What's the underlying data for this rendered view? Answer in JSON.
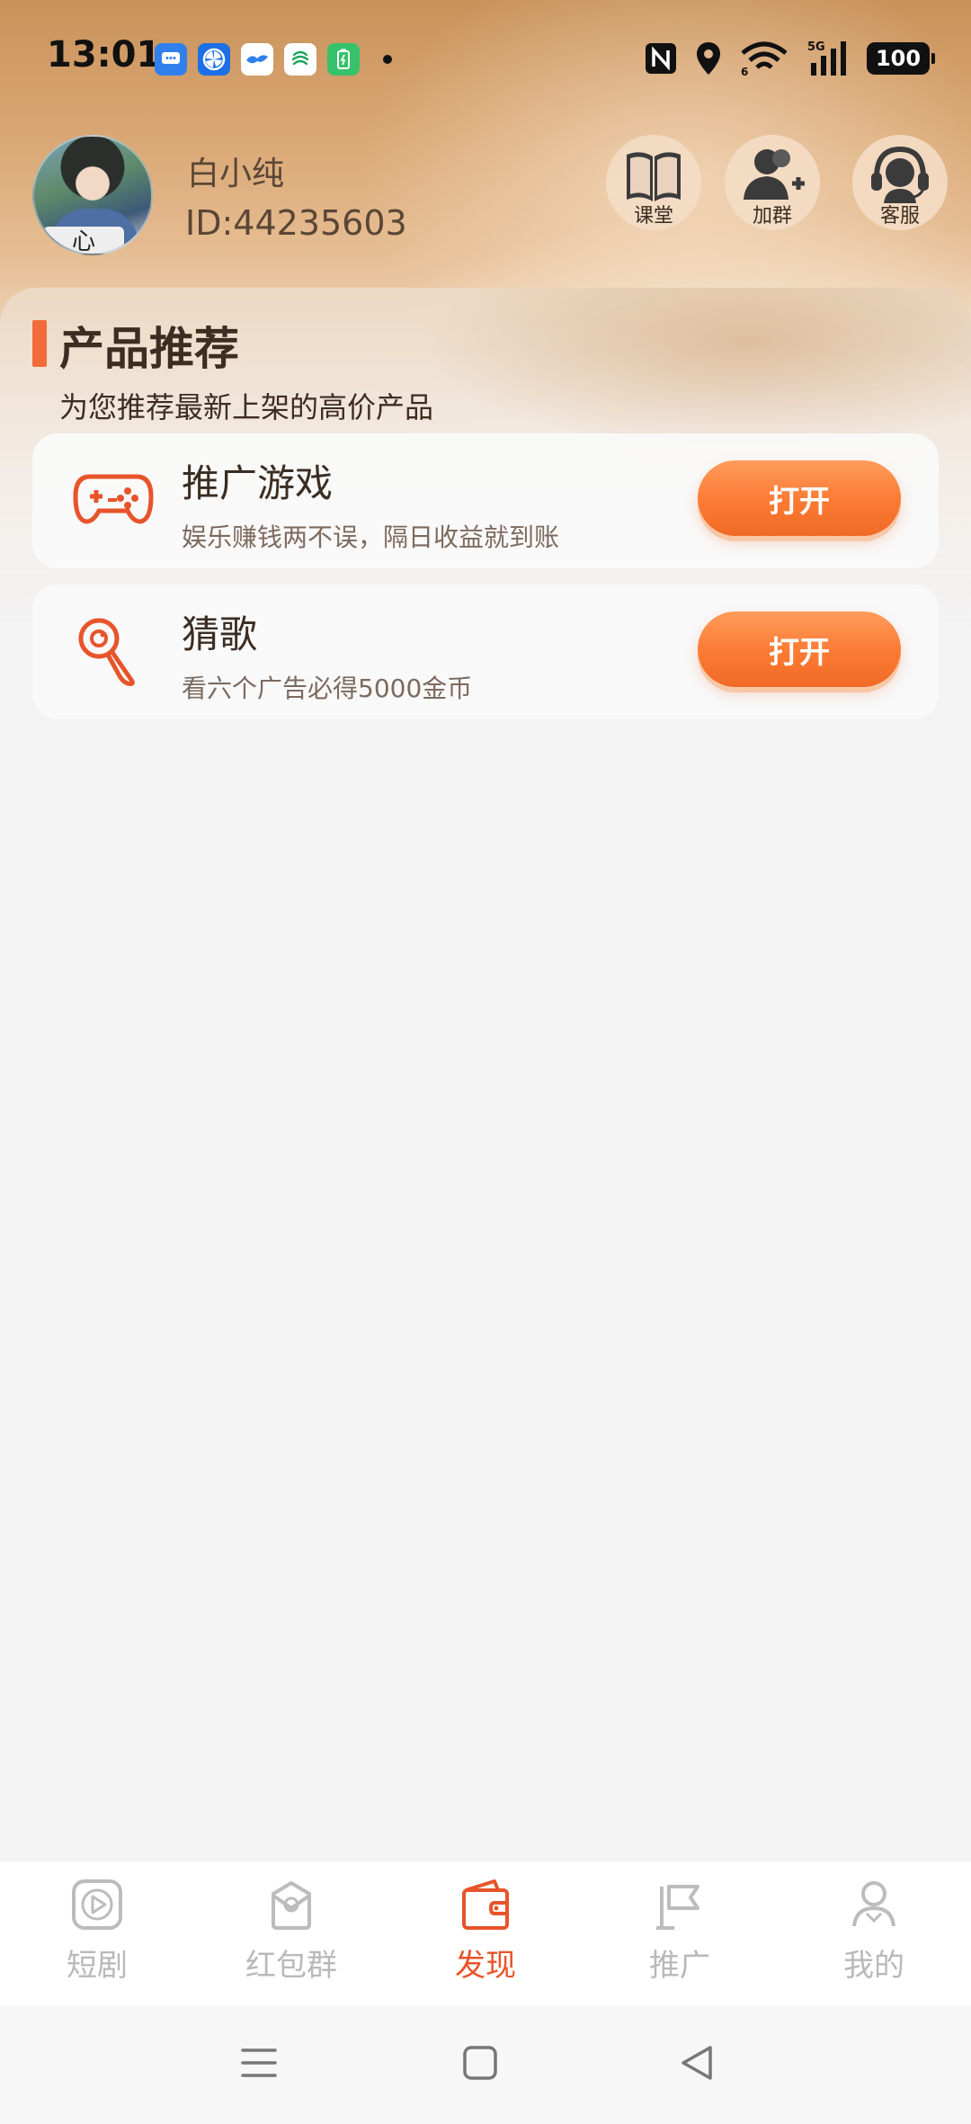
{
  "status_bar": {
    "time": "13:01",
    "battery": "100",
    "network": "5G",
    "icons": [
      "message-icon",
      "pinwheel-icon",
      "bird-icon",
      "china-mobile-icon",
      "battery-saver-icon",
      "nfc-icon",
      "location-icon",
      "wifi-icon",
      "signal-icon"
    ]
  },
  "profile": {
    "name": "白小纯",
    "id": "ID:44235603",
    "avatar_text": "心"
  },
  "quick_actions": [
    {
      "label": "课堂",
      "icon": "book-icon"
    },
    {
      "label": "加群",
      "icon": "add-group-icon"
    },
    {
      "label": "客服",
      "icon": "headset-icon"
    }
  ],
  "section": {
    "title": "产品推荐",
    "subtitle": "为您推荐最新上架的高价产品"
  },
  "products": [
    {
      "title": "推广游戏",
      "desc": "娱乐赚钱两不误，隔日收益就到账",
      "button": "打开",
      "icon": "gamepad-icon"
    },
    {
      "title": "猜歌",
      "desc": "看六个广告必得5000金币",
      "button": "打开",
      "icon": "music-search-icon"
    }
  ],
  "tabs": [
    {
      "label": "短剧",
      "icon": "play-icon",
      "active": false
    },
    {
      "label": "红包群",
      "icon": "red-packet-icon",
      "active": false
    },
    {
      "label": "发现",
      "icon": "wallet-icon",
      "active": true
    },
    {
      "label": "推广",
      "icon": "flag-icon",
      "active": false
    },
    {
      "label": "我的",
      "icon": "user-icon",
      "active": false
    }
  ],
  "colors": {
    "accent": "#e8542a",
    "button": "#fb7a33",
    "title_text": "#3e2c22"
  }
}
